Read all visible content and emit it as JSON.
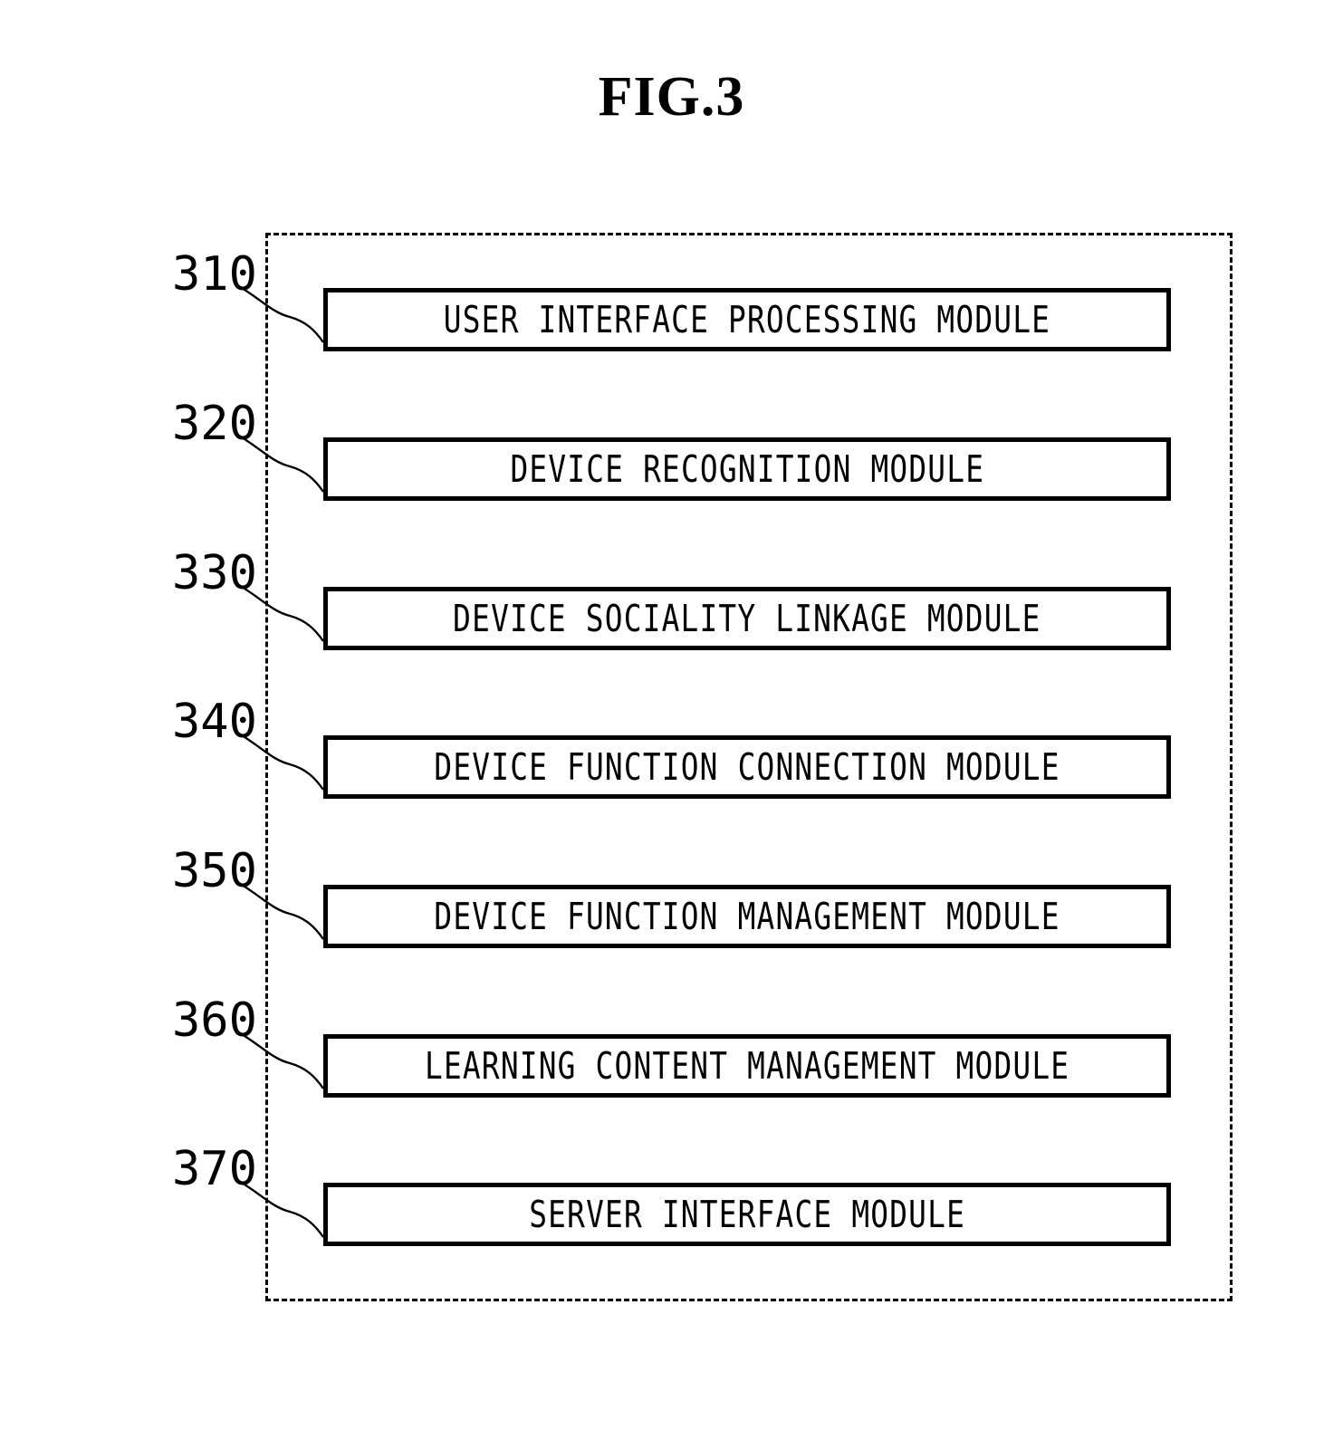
{
  "figure": {
    "title": "FIG.3",
    "frame_style": "dashed",
    "colors": {
      "ink": "#000000",
      "background": "#ffffff"
    }
  },
  "modules": [
    {
      "ref": "310",
      "label": "USER INTERFACE PROCESSING MODULE"
    },
    {
      "ref": "320",
      "label": "DEVICE RECOGNITION MODULE"
    },
    {
      "ref": "330",
      "label": "DEVICE SOCIALITY LINKAGE MODULE"
    },
    {
      "ref": "340",
      "label": "DEVICE FUNCTION CONNECTION MODULE"
    },
    {
      "ref": "350",
      "label": "DEVICE FUNCTION MANAGEMENT MODULE"
    },
    {
      "ref": "360",
      "label": "LEARNING CONTENT MANAGEMENT MODULE"
    },
    {
      "ref": "370",
      "label": "SERVER INTERFACE MODULE"
    }
  ]
}
